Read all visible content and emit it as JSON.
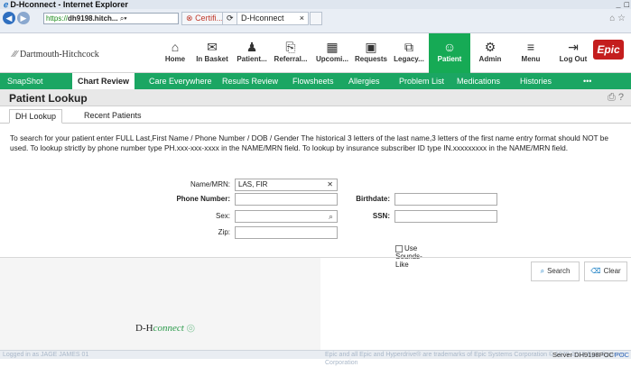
{
  "window": {
    "title": "D-Hconnect - Internet Explorer"
  },
  "browser": {
    "url": "https://dh9198.hitch...",
    "url_https": "https://",
    "url_rest": "dh9198.hitch...",
    "cert_label": "Certifi...",
    "tab_label": "D-Hconnect"
  },
  "brand": {
    "name": "Dartmouth-Hitchcock",
    "epic_badge": "Epic",
    "epic_color": "#c41e1e",
    "accent": "#16aa55"
  },
  "topnav": [
    {
      "label": "Home",
      "icon": "home-icon"
    },
    {
      "label": "In Basket",
      "icon": "mail-icon"
    },
    {
      "label": "Patient...",
      "icon": "patient-station-icon"
    },
    {
      "label": "Referral...",
      "icon": "referral-icon"
    },
    {
      "label": "Upcomi...",
      "icon": "calendar-icon"
    },
    {
      "label": "Requests",
      "icon": "requests-icon"
    },
    {
      "label": "Legacy...",
      "icon": "external-link-icon"
    },
    {
      "label": "Patient",
      "icon": "person-icon"
    },
    {
      "label": "Admin",
      "icon": "gear-icon"
    },
    {
      "label": "Menu",
      "icon": "menu-icon"
    },
    {
      "label": "Log Out",
      "icon": "logout-icon"
    }
  ],
  "activities": [
    "SnapShot",
    "Chart Review",
    "Care Everywhere",
    "Results Review",
    "Flowsheets",
    "Allergies",
    "Problem List",
    "Medications",
    "Histories",
    "•••"
  ],
  "page": {
    "title": "Patient Lookup"
  },
  "subtabs": [
    "DH Lookup",
    "Recent Patients"
  ],
  "instructions": "To search for your patient enter FULL Last,First Name / Phone Number / DOB / Gender The historical 3 letters of the last name,3 letters of the first name entry format should NOT be used. To lookup strictly by phone number type PH.xxx-xxx-xxxx in the NAME/MRN field. To lookup by insurance subscriber ID type IN.xxxxxxxxx in the NAME/MRN field.",
  "form": {
    "name_label": "Name/MRN:",
    "name_value": "LAS, FIR",
    "phone_label": "Phone Number:",
    "sex_label": "Sex:",
    "zip_label": "Zip:",
    "birthdate_label": "Birthdate:",
    "ssn_label": "SSN:",
    "sounds_like_label": "Use Sounds-Like",
    "search_button": "Search",
    "clear_button": "Clear"
  },
  "footer": {
    "product_prefix": "D-H",
    "product_suffix": "connect",
    "status_left": "Logged in as JAGE JAMES 01",
    "status_mid": "Epic and all Epic and Hyperdrive® are trademarks of Epic Systems Corporation © 1979-2019 Epic Systems Corporation",
    "server": "Server DH9198POC",
    "poc": "POC"
  }
}
